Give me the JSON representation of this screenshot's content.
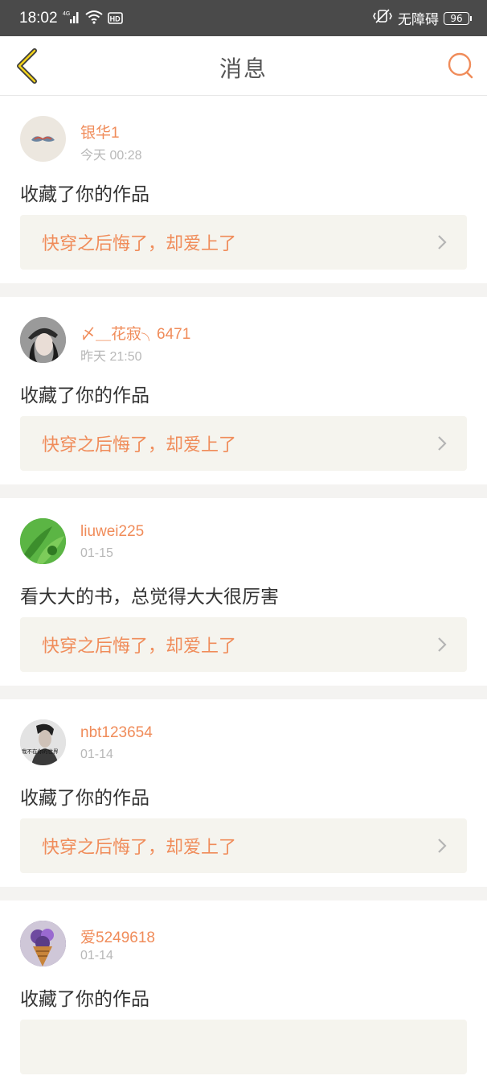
{
  "status_bar": {
    "time": "18:02",
    "network": "4G",
    "hd": "HD",
    "accessibility": "无障碍",
    "battery": "96"
  },
  "header": {
    "title": "消息"
  },
  "messages": [
    {
      "username": "银华1",
      "time": "今天 00:28",
      "text": "收藏了你的作品",
      "work": "快穿之后悔了，却爱上了"
    },
    {
      "username": "〆＿花寂╮6471",
      "time": "昨天 21:50",
      "text": "收藏了你的作品",
      "work": "快穿之后悔了，却爱上了"
    },
    {
      "username": "liuwei225",
      "time": "01-15",
      "text": "看大大的书，总觉得大大很厉害",
      "work": "快穿之后悔了，却爱上了"
    },
    {
      "username": "nbt123654",
      "time": "01-14",
      "text": "收藏了你的作品",
      "work": "快穿之后悔了，却爱上了"
    },
    {
      "username": "爱5249618",
      "time": "01-14",
      "text": "收藏了你的作品",
      "work": ""
    }
  ],
  "avatar_texts": {
    "nbt": "我不在你的世界"
  },
  "colors": {
    "accent": "#f08c5a",
    "status_bar": "#4a4a4a",
    "separator": "#f4f3f1",
    "link_bg": "#f5f4ee"
  }
}
